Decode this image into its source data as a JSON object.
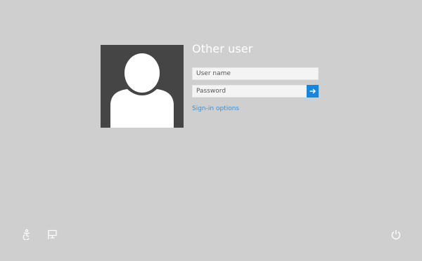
{
  "login": {
    "title": "Other user",
    "username_placeholder": "User name",
    "password_placeholder": "Password",
    "signin_options_label": "Sign-in options"
  },
  "icons": {
    "avatar": "user-silhouette-icon",
    "submit": "arrow-right-icon",
    "ease_of_access": "ease-of-access-icon",
    "network": "network-icon",
    "power": "power-icon"
  },
  "colors": {
    "background": "#cfcfcf",
    "avatar_bg": "#454545",
    "accent": "#1b84d6",
    "link": "#3a8fd9"
  }
}
